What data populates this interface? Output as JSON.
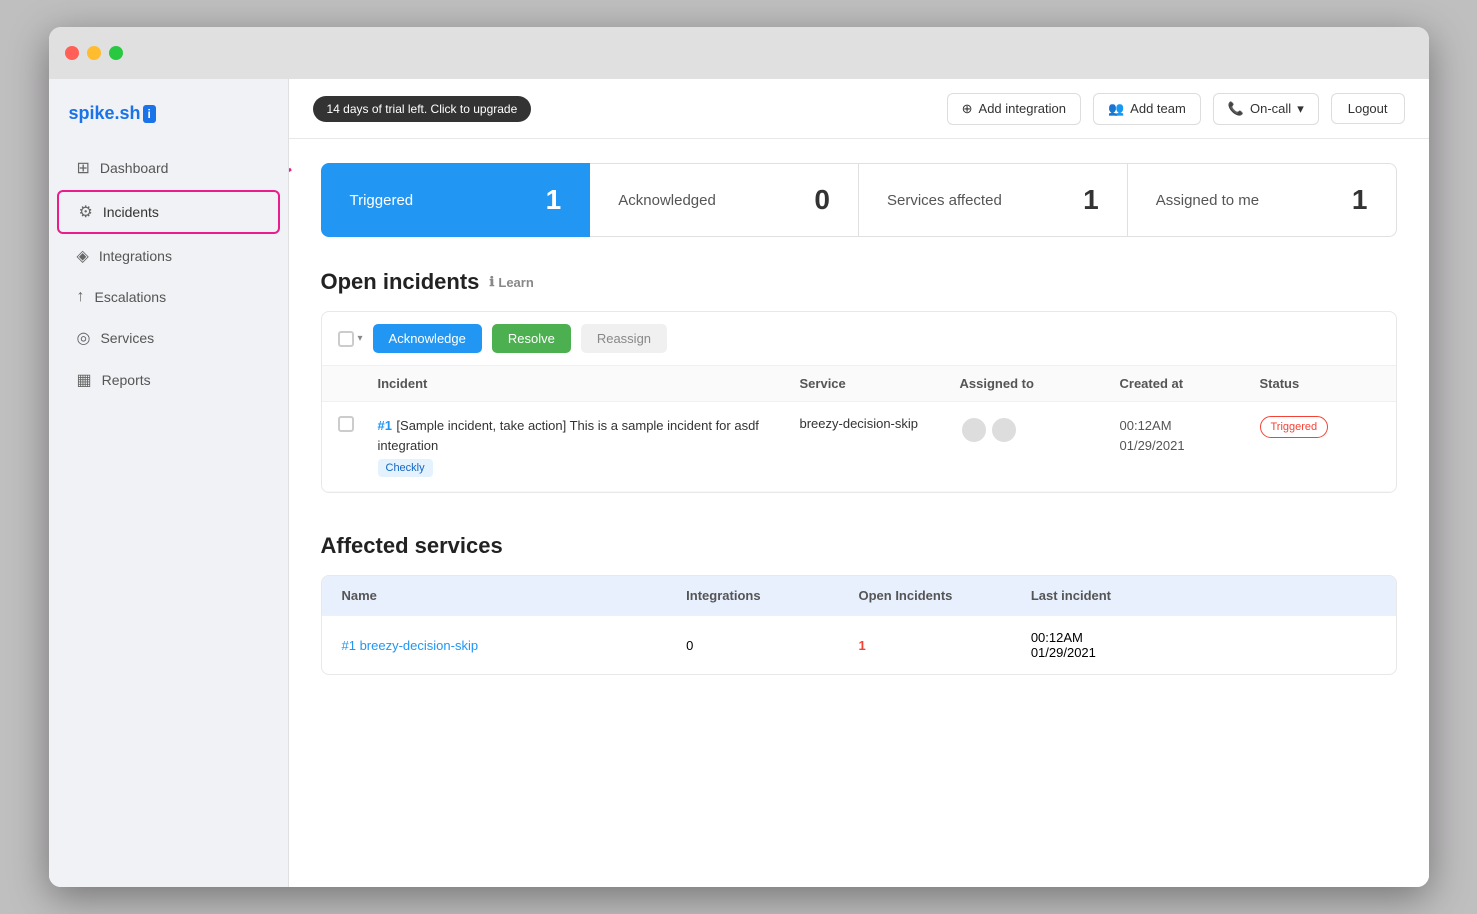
{
  "window": {
    "title": "spike.sh"
  },
  "logo": {
    "text": "spike.sh",
    "badge": "i"
  },
  "trial": {
    "label": "14 days of trial left. Click to upgrade"
  },
  "topbar": {
    "add_integration": "Add integration",
    "add_team": "Add team",
    "on_call": "On-call",
    "logout": "Logout"
  },
  "sidebar": {
    "items": [
      {
        "label": "Dashboard",
        "icon": "⊞",
        "active": false
      },
      {
        "label": "Incidents",
        "icon": "⚙",
        "active": true
      },
      {
        "label": "Integrations",
        "icon": "◈",
        "active": false
      },
      {
        "label": "Escalations",
        "icon": "↑",
        "active": false
      },
      {
        "label": "Services",
        "icon": "◎",
        "active": false
      },
      {
        "label": "Reports",
        "icon": "▦",
        "active": false
      }
    ]
  },
  "stats": [
    {
      "label": "Triggered",
      "count": "1",
      "triggered": true
    },
    {
      "label": "Acknowledged",
      "count": "0",
      "triggered": false
    },
    {
      "label": "Services affected",
      "count": "1",
      "triggered": false
    },
    {
      "label": "Assigned to me",
      "count": "1",
      "triggered": false
    }
  ],
  "open_incidents": {
    "title": "Open incidents",
    "learn_label": "Learn",
    "toolbar": {
      "acknowledge": "Acknowledge",
      "resolve": "Resolve",
      "reassign": "Reassign"
    },
    "table_headers": [
      "",
      "Incident",
      "Service",
      "Assigned to",
      "Created at",
      "Status"
    ],
    "rows": [
      {
        "number": "#1",
        "title": "[Sample incident, take action] This is a sample incident for asdf integration",
        "tag": "Checkly",
        "service": "breezy-decision-skip",
        "created_at": "00:12AM\n01/29/2021",
        "status": "Triggered"
      }
    ]
  },
  "affected_services": {
    "title": "Affected services",
    "headers": [
      "Name",
      "Integrations",
      "Open Incidents",
      "Last incident"
    ],
    "rows": [
      {
        "name": "#1 breezy-decision-skip",
        "integrations": "0",
        "open_incidents": "1",
        "last_incident": "00:12AM\n01/29/2021"
      }
    ]
  }
}
